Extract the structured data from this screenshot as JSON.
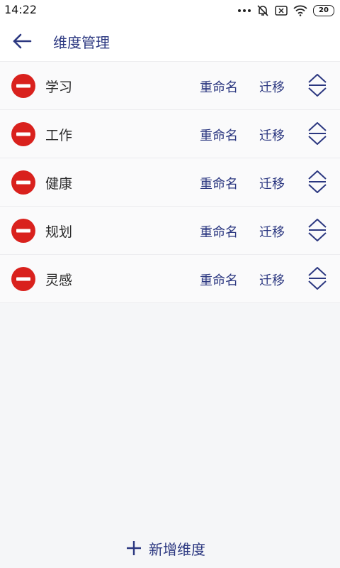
{
  "status_bar": {
    "time": "14:22",
    "battery": "20",
    "icons": [
      "more-dots-icon",
      "alarm-off-icon",
      "sim-off-icon",
      "wifi-icon",
      "battery-icon"
    ]
  },
  "header": {
    "title": "维度管理",
    "back_icon": "arrow-left-icon"
  },
  "dimensions": [
    {
      "label": "学习",
      "rename": "重命名",
      "migrate": "迁移"
    },
    {
      "label": "工作",
      "rename": "重命名",
      "migrate": "迁移"
    },
    {
      "label": "健康",
      "rename": "重命名",
      "migrate": "迁移"
    },
    {
      "label": "规划",
      "rename": "重命名",
      "migrate": "迁移"
    },
    {
      "label": "灵感",
      "rename": "重命名",
      "migrate": "迁移"
    }
  ],
  "footer": {
    "add_label": "新增维度",
    "add_icon": "plus-icon"
  },
  "colors": {
    "accent": "#2b3780",
    "remove": "#d9211d",
    "background": "#f5f6f8"
  }
}
